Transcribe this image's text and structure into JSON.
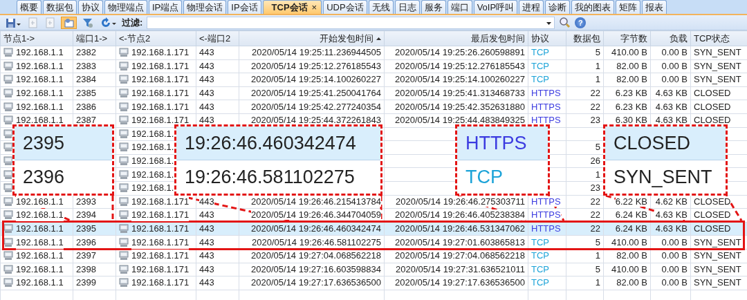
{
  "tabs": [
    {
      "label": "概要",
      "selected": false
    },
    {
      "label": "数据包",
      "selected": false
    },
    {
      "label": "协议",
      "selected": false
    },
    {
      "label": "物理端点",
      "selected": false
    },
    {
      "label": "IP端点",
      "selected": false
    },
    {
      "label": "物理会话",
      "selected": false
    },
    {
      "label": "IP会话",
      "selected": false
    },
    {
      "label": "TCP会话",
      "selected": true,
      "close": "×"
    },
    {
      "label": "UDP会话",
      "selected": false
    },
    {
      "label": "无线",
      "selected": false
    },
    {
      "label": "日志",
      "selected": false
    },
    {
      "label": "服务",
      "selected": false
    },
    {
      "label": "端口",
      "selected": false
    },
    {
      "label": "VoIP呼叫",
      "selected": false
    },
    {
      "label": "进程",
      "selected": false
    },
    {
      "label": "诊断",
      "selected": false
    },
    {
      "label": "我的图表",
      "selected": false
    },
    {
      "label": "矩阵",
      "selected": false
    },
    {
      "label": "报表",
      "selected": false
    }
  ],
  "toolbar": {
    "filter_label": "过滤:",
    "help": "?"
  },
  "table": {
    "columns": [
      {
        "label": "节点1->",
        "sorted": false
      },
      {
        "label": "端口1->",
        "sorted": false
      },
      {
        "label": "<-节点2",
        "sorted": false
      },
      {
        "label": "<-端口2",
        "sorted": false
      },
      {
        "label": "开始发包时间",
        "sorted": true
      },
      {
        "label": "最后发包时间",
        "sorted": false
      },
      {
        "label": "协议",
        "sorted": false
      },
      {
        "label": "数据包",
        "sorted": false
      },
      {
        "label": "字节数",
        "sorted": false
      },
      {
        "label": "负载",
        "sorted": false
      },
      {
        "label": "TCP状态",
        "sorted": false
      }
    ],
    "rows": [
      {
        "kind": "full",
        "selected": false,
        "outlined": false,
        "color": "#1ca3d8",
        "cells": [
          "192.168.1.1",
          "2382",
          "192.168.1.171",
          "443",
          "2020/05/14 19:25:11.236944505",
          "2020/05/14 19:25:26.260598891",
          "TCP",
          "5",
          "410.00 B",
          "0.00 B",
          "SYN_SENT"
        ]
      },
      {
        "kind": "full",
        "selected": false,
        "outlined": false,
        "color": "#1ca3d8",
        "cells": [
          "192.168.1.1",
          "2383",
          "192.168.1.171",
          "443",
          "2020/05/14 19:25:12.276185543",
          "2020/05/14 19:25:12.276185543",
          "TCP",
          "1",
          "82.00 B",
          "0.00 B",
          "SYN_SENT"
        ]
      },
      {
        "kind": "full",
        "selected": false,
        "outlined": false,
        "color": "#1ca3d8",
        "cells": [
          "192.168.1.1",
          "2384",
          "192.168.1.171",
          "443",
          "2020/05/14 19:25:14.100260227",
          "2020/05/14 19:25:14.100260227",
          "TCP",
          "1",
          "82.00 B",
          "0.00 B",
          "SYN_SENT"
        ]
      },
      {
        "kind": "full",
        "selected": false,
        "outlined": false,
        "color": "#3b3be0",
        "cells": [
          "192.168.1.1",
          "2385",
          "192.168.1.171",
          "443",
          "2020/05/14 19:25:41.250041764",
          "2020/05/14 19:25:41.313468733",
          "HTTPS",
          "22",
          "6.23 KB",
          "4.63 KB",
          "CLOSED"
        ]
      },
      {
        "kind": "full",
        "selected": false,
        "outlined": false,
        "color": "#3b3be0",
        "cells": [
          "192.168.1.1",
          "2386",
          "192.168.1.171",
          "443",
          "2020/05/14 19:25:42.277240354",
          "2020/05/14 19:25:42.352631880",
          "HTTPS",
          "22",
          "6.23 KB",
          "4.63 KB",
          "CLOSED"
        ]
      },
      {
        "kind": "full",
        "selected": false,
        "outlined": false,
        "color": "#3b3be0",
        "cells": [
          "192.168.1.1",
          "2387",
          "192.168.1.171",
          "443",
          "2020/05/14 19:25:44.372261843",
          "2020/05/14 19:25:44.483849325",
          "HTTPS",
          "23",
          "6.30 KB",
          "4.63 KB",
          "CLOSED"
        ]
      },
      {
        "kind": "covered",
        "node2": "192.168.1."
      },
      {
        "kind": "covered",
        "node2": "192.168.1.",
        "packets": "5"
      },
      {
        "kind": "covered",
        "node2": "192.168.1.",
        "packets": "26"
      },
      {
        "kind": "covered",
        "node2": "192.168.1.",
        "packets": "1"
      },
      {
        "kind": "covered",
        "node2": "192.168.1.",
        "packets": "23"
      },
      {
        "kind": "full",
        "selected": false,
        "outlined": false,
        "color": "#3b3be0",
        "cells": [
          "192.168.1.1",
          "2393",
          "192.168.1.171",
          "443",
          "2020/05/14 19:26:46.215413784",
          "2020/05/14 19:26:46.275303711",
          "HTTPS",
          "22",
          "6.22 KB",
          "4.62 KB",
          "CLOSED"
        ]
      },
      {
        "kind": "full",
        "selected": false,
        "outlined": false,
        "color": "#3b3be0",
        "cells": [
          "192.168.1.1",
          "2394",
          "192.168.1.171",
          "443",
          "2020/05/14 19:26:46.344704059",
          "2020/05/14 19:26:46.405238384",
          "HTTPS",
          "22",
          "6.24 KB",
          "4.63 KB",
          "CLOSED"
        ]
      },
      {
        "kind": "full",
        "selected": true,
        "outlined": true,
        "color": "#3b3be0",
        "cells": [
          "192.168.1.1",
          "2395",
          "192.168.1.171",
          "443",
          "2020/05/14 19:26:46.460342474",
          "2020/05/14 19:26:46.531347062",
          "HTTPS",
          "22",
          "6.24 KB",
          "4.63 KB",
          "CLOSED"
        ]
      },
      {
        "kind": "full",
        "selected": false,
        "outlined": true,
        "color": "#1ca3d8",
        "cells": [
          "192.168.1.1",
          "2396",
          "192.168.1.171",
          "443",
          "2020/05/14 19:26:46.581102275",
          "2020/05/14 19:27:01.603865813",
          "TCP",
          "5",
          "410.00 B",
          "0.00 B",
          "SYN_SENT"
        ]
      },
      {
        "kind": "full",
        "selected": false,
        "outlined": false,
        "color": "#1ca3d8",
        "cells": [
          "192.168.1.1",
          "2397",
          "192.168.1.171",
          "443",
          "2020/05/14 19:27:04.068562218",
          "2020/05/14 19:27:04.068562218",
          "TCP",
          "1",
          "82.00 B",
          "0.00 B",
          "SYN_SENT"
        ]
      },
      {
        "kind": "full",
        "selected": false,
        "outlined": false,
        "color": "#1ca3d8",
        "cells": [
          "192.168.1.1",
          "2398",
          "192.168.1.171",
          "443",
          "2020/05/14 19:27:16.603598834",
          "2020/05/14 19:27:31.636521011",
          "TCP",
          "5",
          "410.00 B",
          "0.00 B",
          "SYN_SENT"
        ]
      },
      {
        "kind": "full",
        "selected": false,
        "outlined": false,
        "color": "#1ca3d8",
        "cells": [
          "192.168.1.1",
          "2399",
          "192.168.1.171",
          "443",
          "2020/05/14 19:27:17.636536500",
          "2020/05/14 19:27:17.636536500",
          "TCP",
          "1",
          "82.00 B",
          "0.00 B",
          "SYN_SENT"
        ]
      }
    ]
  },
  "callouts": [
    {
      "lines": [
        {
          "text": "2395",
          "selected": true
        },
        {
          "text": "2396",
          "selected": false
        }
      ]
    },
    {
      "lines": [
        {
          "text": "19:26:46.460342474",
          "selected": true
        },
        {
          "text": "19:26:46.581102275",
          "selected": false
        }
      ]
    },
    {
      "lines": [
        {
          "text": "HTTPS",
          "selected": true,
          "color": "#3b3be0"
        },
        {
          "text": "TCP",
          "selected": false,
          "color": "#1ca3d8"
        }
      ]
    },
    {
      "lines": [
        {
          "text": "CLOSED",
          "selected": true
        },
        {
          "text": "SYN_SENT",
          "selected": false
        }
      ]
    }
  ]
}
